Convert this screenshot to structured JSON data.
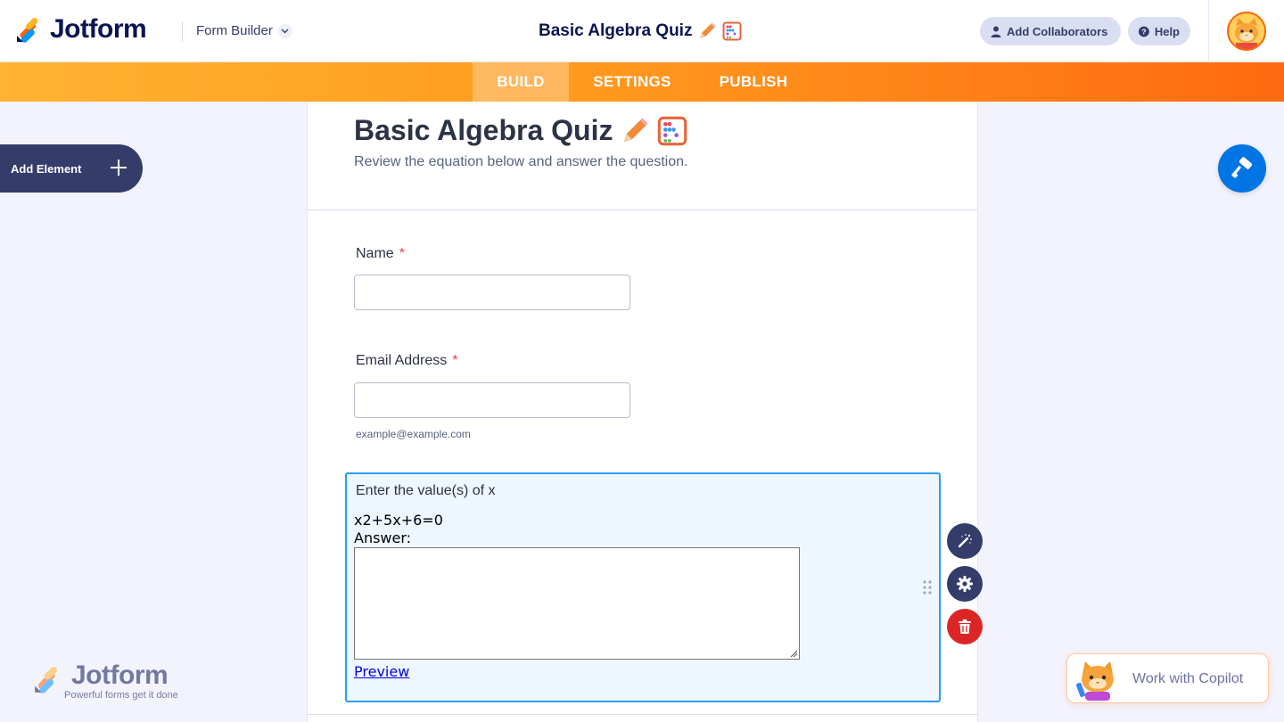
{
  "header": {
    "brand": "Jotform",
    "builder_label": "Form Builder",
    "title": "Basic Algebra Quiz",
    "collaborators_label": "Add Collaborators",
    "help_label": "Help"
  },
  "nav": {
    "tabs": [
      {
        "label": "BUILD",
        "active": true
      },
      {
        "label": "SETTINGS",
        "active": false
      },
      {
        "label": "PUBLISH",
        "active": false
      }
    ]
  },
  "sidebar": {
    "add_element_label": "Add Element"
  },
  "form": {
    "heading": "Basic Algebra Quiz",
    "subheading": "Review the equation below and answer the question.",
    "fields": [
      {
        "label": "Name",
        "required": true,
        "value": "",
        "sublabel": ""
      },
      {
        "label": "Email Address",
        "required": true,
        "value": "",
        "sublabel": "example@example.com"
      }
    ],
    "question": {
      "title": "Enter the value(s) of x",
      "equation": "x2+5x+6=0",
      "answer_label": "Answer:",
      "answer_value": "",
      "preview_link": "Preview"
    },
    "required_marker": "*"
  },
  "watermark": {
    "brand": "Jotform",
    "tagline": "Powerful forms get it done"
  },
  "copilot": {
    "label": "Work with Copilot"
  },
  "colors": {
    "brand_navy": "#0a1551",
    "accent_orange": "#ff6100",
    "selection_blue": "#2e9cf3",
    "designer_blue": "#0075e3",
    "delete_red": "#dc2626"
  }
}
